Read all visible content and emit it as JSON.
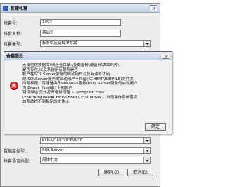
{
  "main_window": {
    "title": "新建帐套",
    "close_glyph": "×",
    "fields": [
      {
        "label": "帐套号:",
        "value": "1007",
        "combo": false
      },
      {
        "label": "帐套名称:",
        "value": "基础司",
        "combo": false
      },
      {
        "label": "帐套类型:",
        "value": "标准供应链解决方案",
        "combo": true
      },
      {
        "label": "",
        "value": "",
        "combo": false
      },
      {
        "label": "数据库类型:",
        "value": "SQL Server",
        "combo": true
      },
      {
        "label": "帐套语言类型:",
        "value": "简体中文",
        "combo": true
      }
    ],
    "server_field_value": "KLN-VOLO7OOFWO7",
    "ok_label": "确定(O)",
    "cancel_label": "取消(C)"
  },
  "error_dialog": {
    "title": "金蝶提示",
    "close_glyph": "×",
    "message_lines": [
      "无法创建数据库!请检查目录:\\金蝶备份\\德富商\\2018\\外\\",
      "是否存在,以及系统所有服务是否",
      "帐户在SQL Server服务的启动用户对其有读写访问",
      "成 SQLServer服务的启动用户不具备(KCHERP\\BBPFILE)文件夹",
      "的写权限。可能是由于Windows服务中SQLServer服务的启动用户",
      "为 Power User组以上的帐户",
      "错误描述:无法打开备份设备 'D:\\Program Files",
      "(x86)\\Kingdee\\KCHERP\\BBPFILE\\SCM.bak'。出现操作系统错误",
      "2(系统找不到指定的文件。)。"
    ],
    "ok_label": "确定"
  }
}
